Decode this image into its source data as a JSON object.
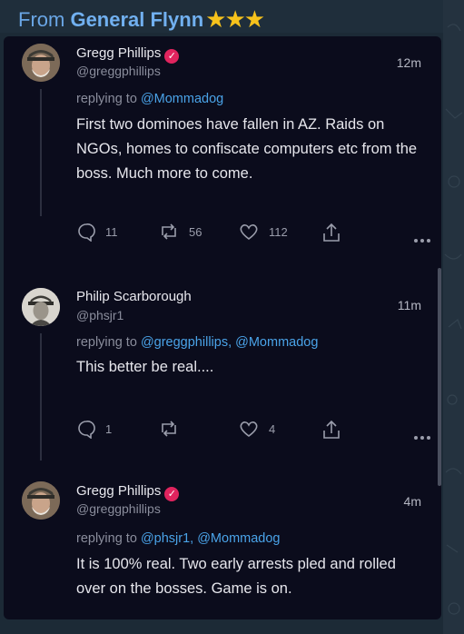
{
  "header": {
    "prefix": "From",
    "name": "General Flynn",
    "stars": "★★★"
  },
  "colors": {
    "background": "#0b0c1c",
    "mention": "#4aa3e8",
    "verified": "#e0245e",
    "header_text": "#6aa6e6",
    "stars": "#f6c21c"
  },
  "tweets": [
    {
      "name": "Gregg Phillips",
      "handle": "@greggphillips",
      "verified": true,
      "time": "12m",
      "reply_prefix": "replying to",
      "reply_mentions": "@Mommadog",
      "body": "First two dominoes have fallen in AZ. Raids on NGOs, homes to confiscate computers etc from the boss. Much more to come.",
      "replies": "11",
      "retweets": "56",
      "likes": "112"
    },
    {
      "name": "Philip Scarborough",
      "handle": "@phsjr1",
      "verified": false,
      "time": "11m",
      "reply_prefix": "replying to",
      "reply_mentions": "@greggphillips, @Mommadog",
      "body": "This better be real....",
      "replies": "1",
      "retweets": "",
      "likes": "4"
    },
    {
      "name": "Gregg Phillips",
      "handle": "@greggphillips",
      "verified": true,
      "time": "4m",
      "reply_prefix": "replying to",
      "reply_mentions": "@phsjr1, @Mommadog",
      "body": "It is 100% real. Two early arrests pled and rolled over on the bosses. Game is on."
    }
  ],
  "icons": [
    "reply-icon",
    "retweet-icon",
    "like-icon",
    "share-icon",
    "more-icon",
    "verified-icon"
  ]
}
